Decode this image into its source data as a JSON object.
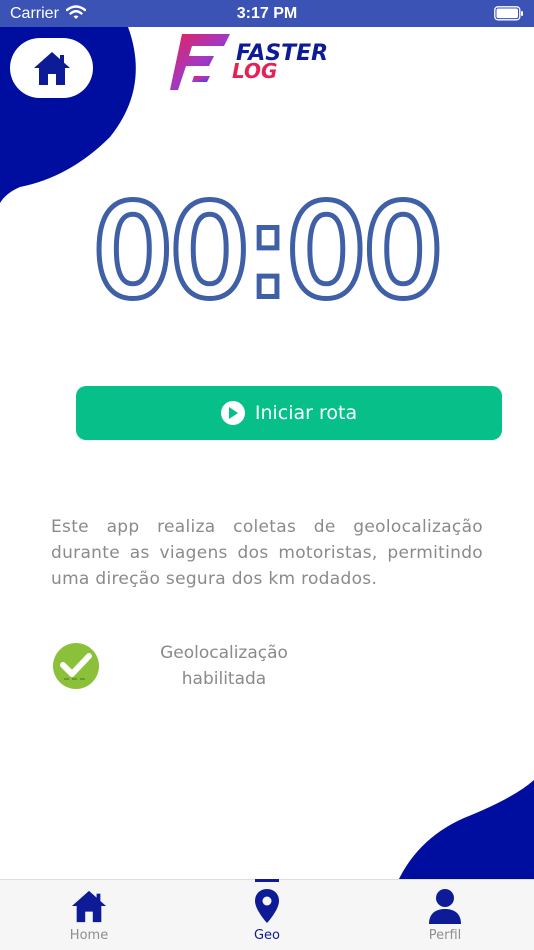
{
  "status_bar": {
    "carrier": "Carrier",
    "time": "3:17 PM"
  },
  "header": {
    "logo_line1": "FASTER",
    "logo_line2": "LOG"
  },
  "timer": {
    "value": "00:00"
  },
  "start_button": {
    "label": "Iniciar rota"
  },
  "info": {
    "text": "Este app realiza coletas de geolocalização durante as viagens dos motoristas, permitindo uma direção segura dos km rodados."
  },
  "geolocation": {
    "line1": "Geolocalização",
    "line2": "habilitada"
  },
  "tabs": [
    {
      "label": "Home",
      "icon": "home-icon"
    },
    {
      "label": "Geo",
      "icon": "location-pin-icon",
      "active": true
    },
    {
      "label": "Perfil",
      "icon": "person-icon"
    }
  ],
  "colors": {
    "brand_blue": "#0d1c96",
    "accent_green": "#07c089",
    "timer_blue": "#3f5fa6",
    "status_bar": "#3a53b4",
    "check_green": "#8bc13a"
  }
}
